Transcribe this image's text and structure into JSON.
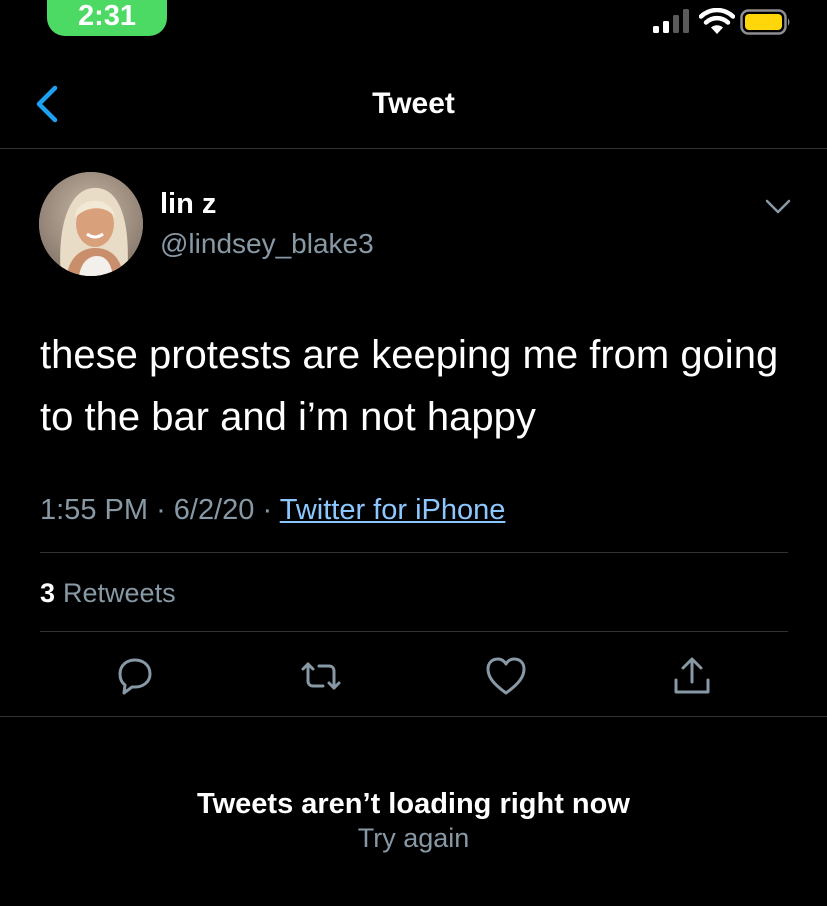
{
  "status_bar": {
    "time": "2:31",
    "time_pill_color": "#4cd964",
    "battery_color": "#ffd60a",
    "signal_icon": "cellular-signal-icon",
    "wifi_icon": "wifi-icon",
    "battery_icon": "battery-icon"
  },
  "header": {
    "title": "Tweet",
    "back_icon": "chevron-left-icon",
    "accent": "#1da1f2"
  },
  "tweet": {
    "author": {
      "display_name": "lin z",
      "handle": "@lindsey_blake3",
      "avatar_icon": "profile-photo"
    },
    "text": "these protests are keeping me from going to the bar and i’m not happy",
    "time": "1:55 PM",
    "date": "6/2/20",
    "separator": "·",
    "source": "Twitter for iPhone",
    "retweets": {
      "count": "3",
      "label": "Retweets"
    },
    "actions": [
      {
        "name": "reply",
        "icon": "speech-bubble-icon"
      },
      {
        "name": "retweet",
        "icon": "retweet-icon"
      },
      {
        "name": "like",
        "icon": "heart-icon"
      },
      {
        "name": "share",
        "icon": "share-icon"
      }
    ]
  },
  "replies_error": {
    "title": "Tweets aren’t loading right now",
    "retry": "Try again"
  }
}
